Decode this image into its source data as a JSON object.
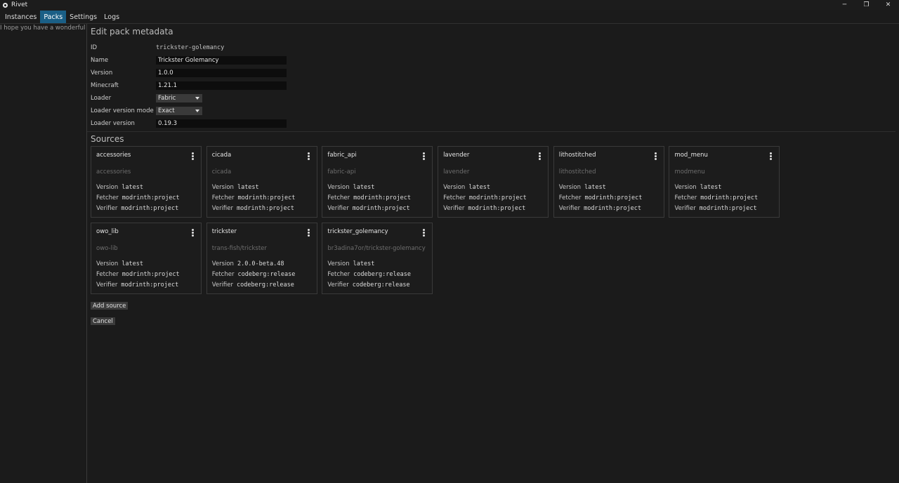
{
  "window": {
    "title": "Rivet",
    "minimize": "─",
    "maximize": "❐",
    "close": "✕"
  },
  "menu": {
    "items": [
      "Instances",
      "Packs",
      "Settings",
      "Logs"
    ],
    "active": "Packs"
  },
  "sidebar": {
    "greeting": "I hope you have a wonderful day"
  },
  "editor": {
    "heading": "Edit pack metadata",
    "id_label": "ID",
    "id_value": "trickster-golemancy",
    "name_label": "Name",
    "name_value": "Trickster Golemancy",
    "version_label": "Version",
    "version_value": "1.0.0",
    "minecraft_label": "Minecraft",
    "minecraft_value": "1.21.1",
    "loader_label": "Loader",
    "loader_value": "Fabric",
    "loader_mode_label": "Loader version mode",
    "loader_mode_value": "Exact",
    "loader_version_label": "Loader version",
    "loader_version_value": "0.19.3"
  },
  "sources": {
    "title": "Sources",
    "labels": {
      "version": "Version",
      "fetcher": "Fetcher",
      "verifier": "Verifier"
    },
    "items": [
      {
        "name": "accessories",
        "source": "accessories",
        "version": "latest",
        "fetcher": "modrinth:project",
        "verifier": "modrinth:project"
      },
      {
        "name": "cicada",
        "source": "cicada",
        "version": "latest",
        "fetcher": "modrinth:project",
        "verifier": "modrinth:project"
      },
      {
        "name": "fabric_api",
        "source": "fabric-api",
        "version": "latest",
        "fetcher": "modrinth:project",
        "verifier": "modrinth:project"
      },
      {
        "name": "lavender",
        "source": "lavender",
        "version": "latest",
        "fetcher": "modrinth:project",
        "verifier": "modrinth:project"
      },
      {
        "name": "lithostitched",
        "source": "lithostitched",
        "version": "latest",
        "fetcher": "modrinth:project",
        "verifier": "modrinth:project"
      },
      {
        "name": "mod_menu",
        "source": "modmenu",
        "version": "latest",
        "fetcher": "modrinth:project",
        "verifier": "modrinth:project"
      },
      {
        "name": "owo_lib",
        "source": "owo-lib",
        "version": "latest",
        "fetcher": "modrinth:project",
        "verifier": "modrinth:project"
      },
      {
        "name": "trickster",
        "source": "trans-fish/trickster",
        "version": "2.0.0-beta.48",
        "fetcher": "codeberg:release",
        "verifier": "codeberg:release"
      },
      {
        "name": "trickster_golemancy",
        "source": "br3adina7or/trickster-golemancy",
        "version": "latest",
        "fetcher": "codeberg:release",
        "verifier": "codeberg:release"
      }
    ]
  },
  "actions": {
    "add_source": "Add source",
    "cancel": "Cancel"
  }
}
